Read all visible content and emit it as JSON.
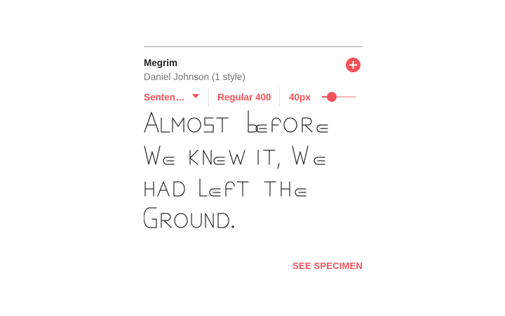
{
  "font_card": {
    "name": "Megrim",
    "designer": "Daniel Johnson (1 style)",
    "add_icon": "plus-icon",
    "controls": {
      "sentence_dropdown": "Senten…",
      "dropdown_icon": "caret-down-icon",
      "weight": "Regular 400",
      "size": "40px",
      "size_slider_level": 0.3
    },
    "preview_text": {
      "full": "Almost before we knew it, we had left the ground.",
      "lines": [
        "Almost before",
        "we knew it, we",
        "had left the",
        "ground."
      ]
    },
    "see_specimen": "SEE SPECIMEN",
    "accent_color": "#f4525a"
  }
}
